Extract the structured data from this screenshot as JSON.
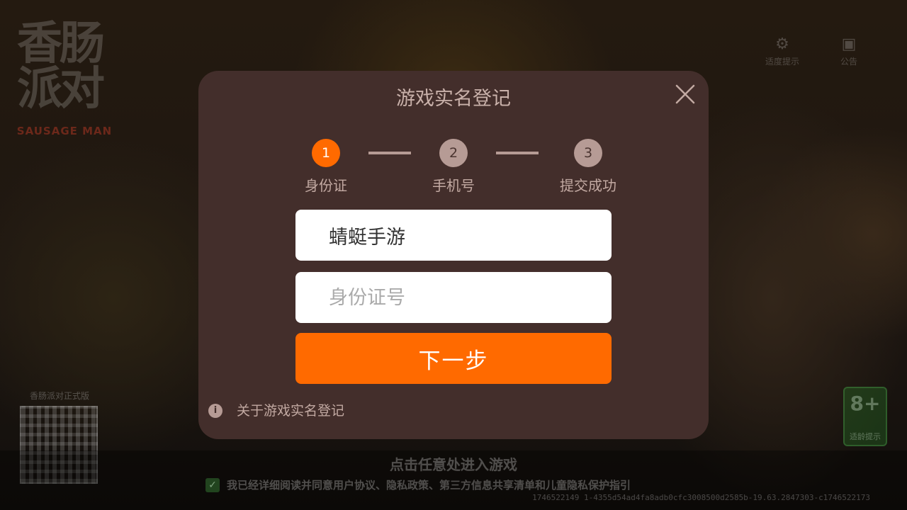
{
  "background": {
    "logo_line1": "香肠",
    "logo_line2": "派对",
    "logo_sub": "SAUSAGE MAN",
    "top_right": [
      {
        "icon": "sliders-icon",
        "glyph": "⚙",
        "label": "适度提示"
      },
      {
        "icon": "notice-icon",
        "glyph": "▣",
        "label": "公告"
      }
    ],
    "qr_label": "香肠派对正式版",
    "age_badge": {
      "number": "8+",
      "label": "适龄提示"
    },
    "enter_text": "点击任意处进入游戏",
    "agreement_text": "我已经详细阅读并同意用户协议、隐私政策、第三方信息共享清单和儿童隐私保护指引",
    "agreement_checked": true,
    "build_info": "1746522149 1-4355d54ad4fa8adb0cfc3008500d2585b-19.63.2847303-c1746522173"
  },
  "modal": {
    "title": "游戏实名登记",
    "steps": [
      {
        "number": "1",
        "label": "身份证",
        "active": true
      },
      {
        "number": "2",
        "label": "手机号",
        "active": false
      },
      {
        "number": "3",
        "label": "提交成功",
        "active": false
      }
    ],
    "name_field": {
      "value": "蜻蜓手游",
      "placeholder": ""
    },
    "id_field": {
      "value": "",
      "placeholder": "身份证号"
    },
    "next_button": "下一步",
    "info_icon_glyph": "i",
    "about_link": "关于游戏实名登记",
    "accent_color": "#ff6a00"
  }
}
